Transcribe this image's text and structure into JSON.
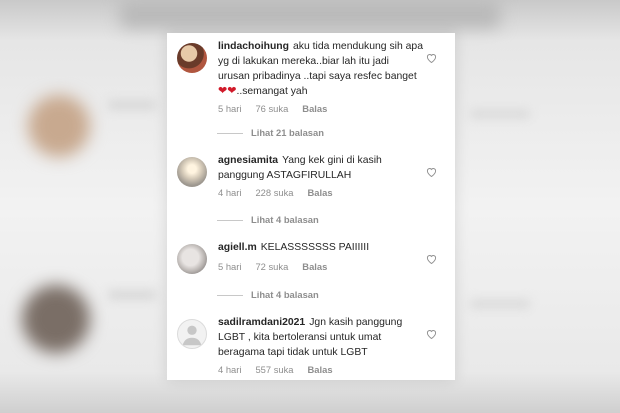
{
  "comments": [
    {
      "username": "lindachoihung",
      "text": "aku tida mendukung sih apa yg di lakukan mereka..biar lah itu jadi urusan pribadinya ..tapi saya resfec banget",
      "text_suffix": "..semangat yah",
      "emoji": "❤❤",
      "time": "5 hari",
      "likes": "76 suka",
      "reply": "Balas",
      "view_replies": "Lihat 21 balasan"
    },
    {
      "username": "agnesiamita",
      "text": "Yang kek gini di kasih panggung ASTAGFIRULLAH",
      "time": "4 hari",
      "likes": "228 suka",
      "reply": "Balas",
      "view_replies": "Lihat 4 balasan"
    },
    {
      "username": "agiell.m",
      "text": "KELASSSSSSS PAIIIIII",
      "time": "5 hari",
      "likes": "72 suka",
      "reply": "Balas",
      "view_replies": "Lihat 4 balasan"
    },
    {
      "username": "sadilramdani2021",
      "text": "Jgn kasih panggung LGBT , kita bertoleransi untuk umat beragama tapi tidak untuk LGBT",
      "time": "4 hari",
      "likes": "557 suka",
      "reply": "Balas"
    }
  ],
  "colors": {
    "text": "#262626",
    "meta": "#8e8e8e",
    "emoji_heart": "#d11a2a"
  },
  "icons": {
    "like": "heart-outline-icon"
  }
}
